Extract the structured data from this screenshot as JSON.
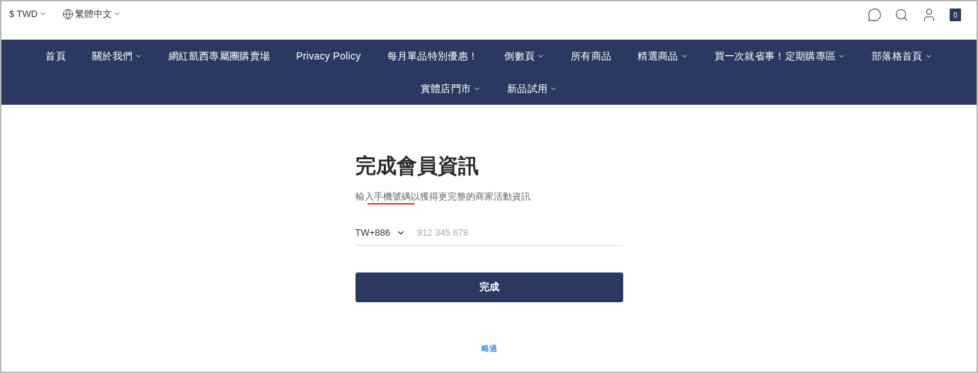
{
  "top_bar": {
    "currency": "$ TWD",
    "language": "繁體中文",
    "cart_count": "0"
  },
  "nav": [
    {
      "label": "首頁",
      "has_dropdown": false
    },
    {
      "label": "關於我們",
      "has_dropdown": true
    },
    {
      "label": "網紅凱西專屬團購賣場",
      "has_dropdown": false
    },
    {
      "label": "Privacy Policy",
      "has_dropdown": false
    },
    {
      "label": "每月單品特別優惠！",
      "has_dropdown": false
    },
    {
      "label": "倒數頁",
      "has_dropdown": true
    },
    {
      "label": "所有商品",
      "has_dropdown": false
    },
    {
      "label": "精選商品",
      "has_dropdown": true
    },
    {
      "label": "買一次就省事！定期購專區",
      "has_dropdown": true
    },
    {
      "label": "部落格首頁",
      "has_dropdown": true
    },
    {
      "label": "實體店門市",
      "has_dropdown": true
    },
    {
      "label": "新品試用",
      "has_dropdown": true
    }
  ],
  "form": {
    "title": "完成會員資訊",
    "subtitle": "輸入手機號碼以獲得更完整的商家活動資訊",
    "country_code": "TW+886",
    "phone_placeholder": "912 345 678",
    "submit": "完成",
    "skip": "略過"
  }
}
